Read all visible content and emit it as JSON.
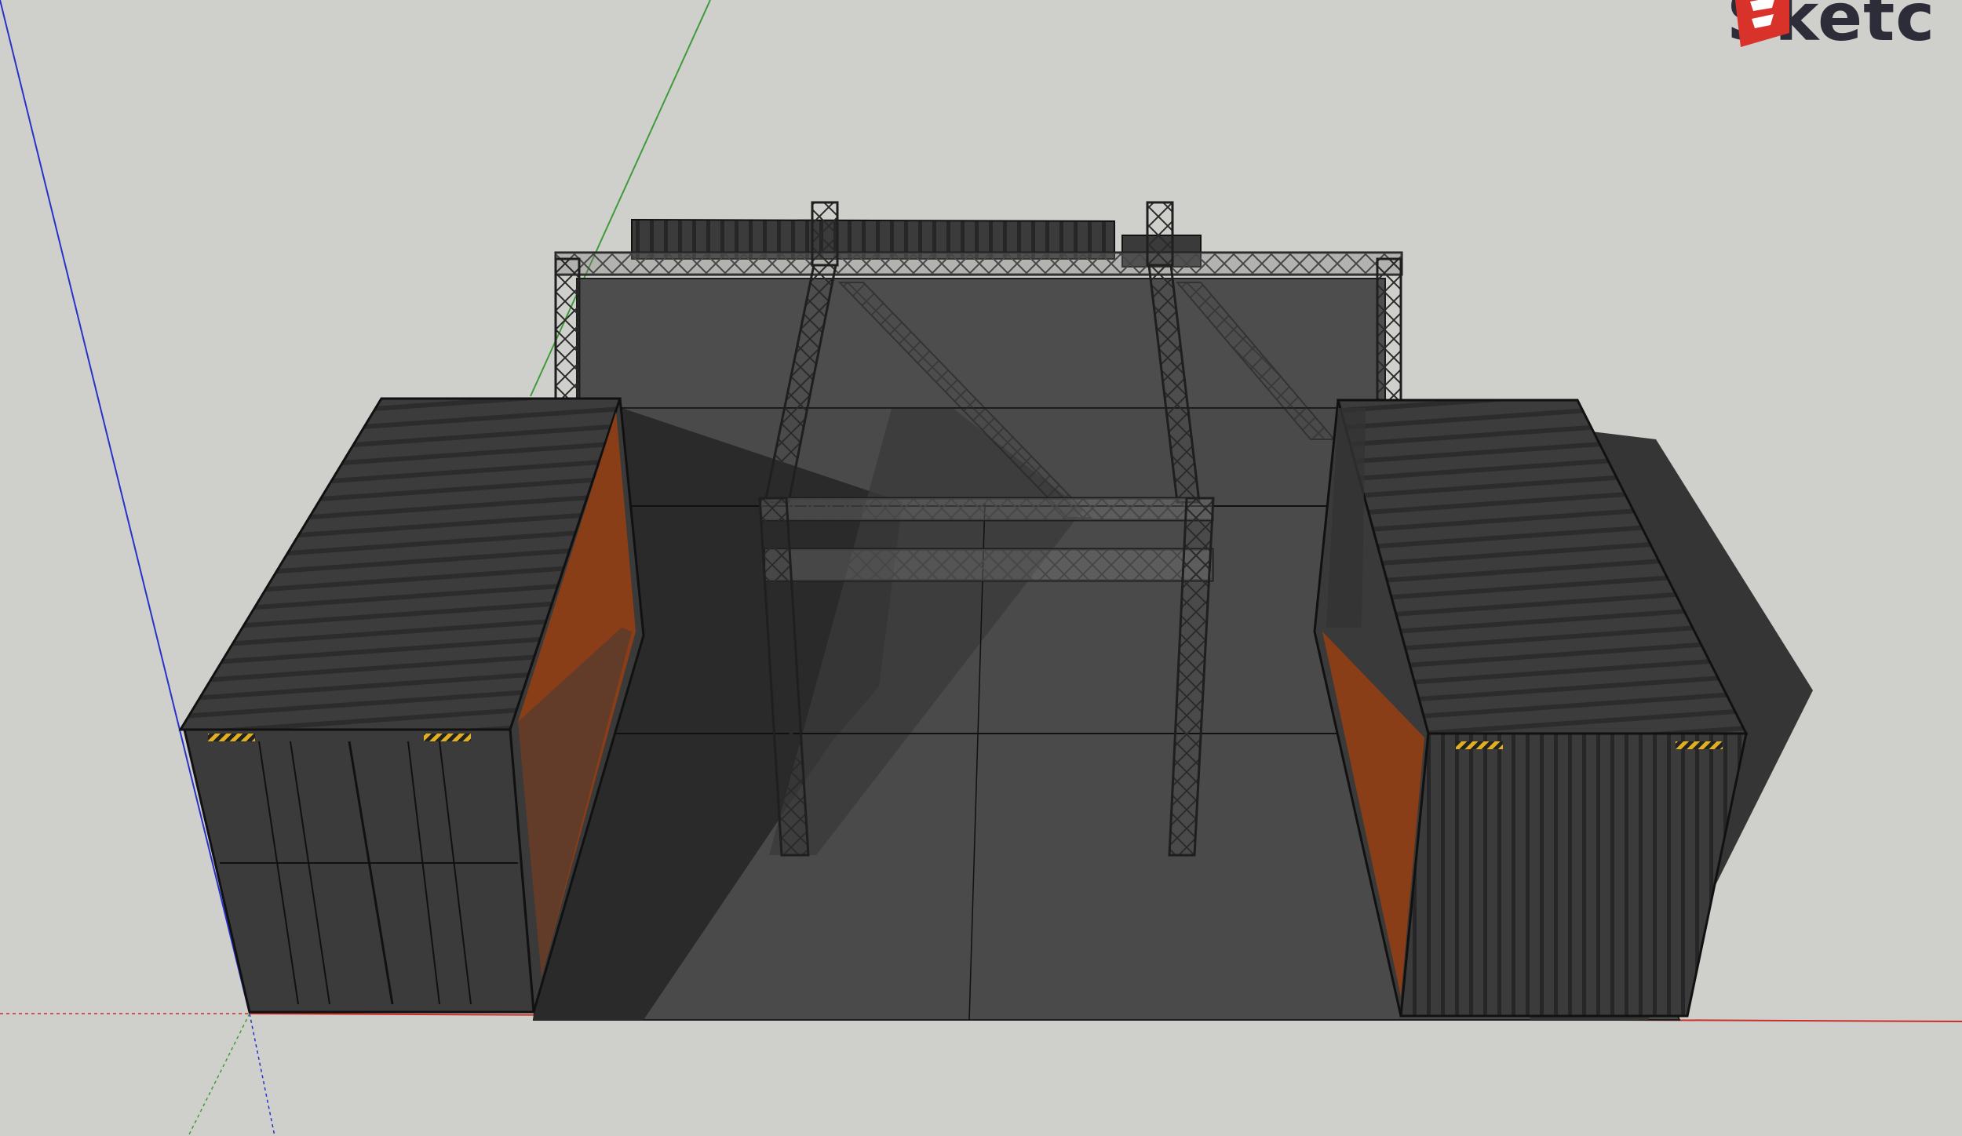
{
  "app": {
    "logo_text": "Sketc"
  },
  "colors": {
    "background": "#cfd0cb",
    "ground": "#4a4a4a",
    "container": "#3e3e3e",
    "container_dark": "#2b2b2b",
    "truss": "#6b6b6b",
    "rust": "#8a3e17",
    "axis_red": "#c8302a",
    "axis_green": "#3f9b3a",
    "axis_blue": "#2632c8",
    "warning_stripe": "#e0b020",
    "logo_red": "#d8322b"
  },
  "scene": {
    "icons": [
      "sketchup-logo-icon",
      "axis-origin-icon"
    ]
  }
}
